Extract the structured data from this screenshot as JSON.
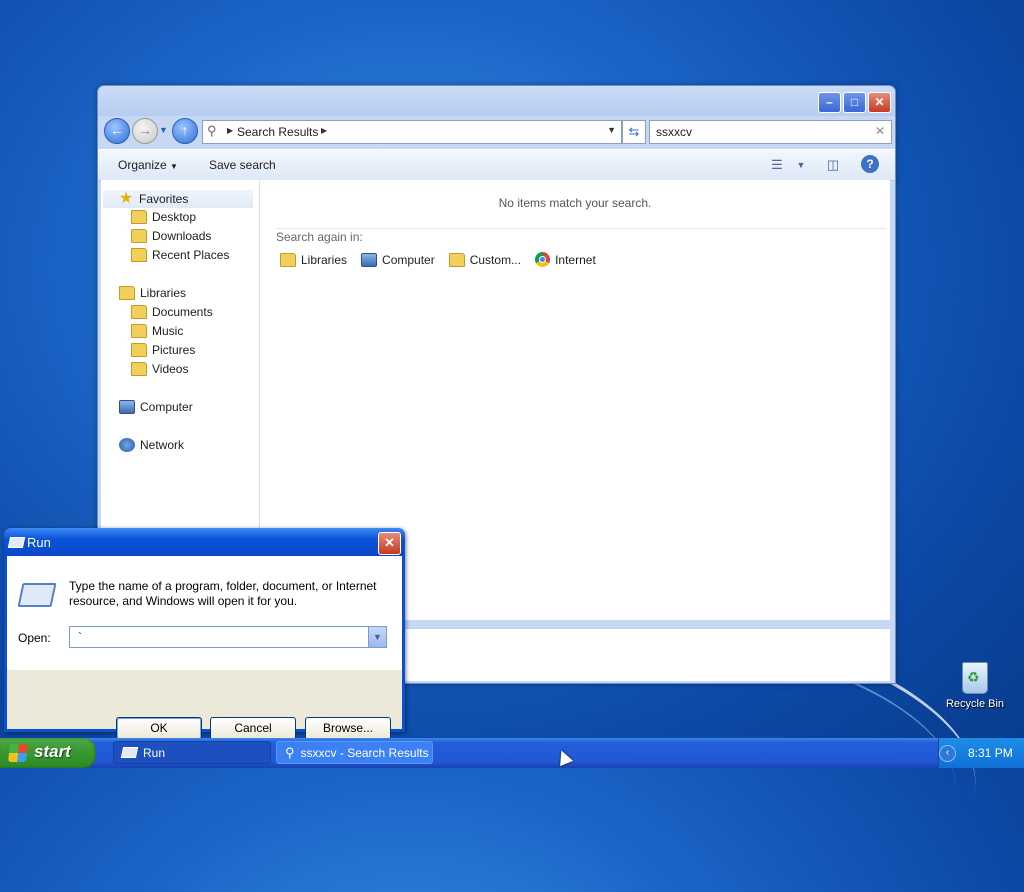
{
  "explorer": {
    "breadcrumb": "Search Results",
    "search_value": "ssxxcv",
    "toolbar": {
      "organize": "Organize",
      "save_search": "Save search"
    },
    "nav": {
      "favorites": "Favorites",
      "desktop": "Desktop",
      "downloads": "Downloads",
      "recent": "Recent Places",
      "libraries": "Libraries",
      "documents": "Documents",
      "music": "Music",
      "pictures": "Pictures",
      "videos": "Videos",
      "computer": "Computer",
      "network": "Network"
    },
    "content": {
      "no_items": "No items match your search.",
      "search_again": "Search again in:",
      "options": [
        "Libraries",
        "Computer",
        "Custom...",
        "Internet"
      ]
    }
  },
  "run": {
    "title": "Run",
    "description": "Type the name of a program, folder, document, or Internet resource, and Windows will open it for you.",
    "open_label": "Open:",
    "open_value": "`",
    "ok": "OK",
    "cancel": "Cancel",
    "browse": "Browse..."
  },
  "taskbar": {
    "start": "start",
    "tasks": [
      "Run",
      "ssxxcv - Search Results"
    ],
    "clock": "8:31 PM"
  },
  "desktop": {
    "recycle_bin": "Recycle Bin"
  }
}
